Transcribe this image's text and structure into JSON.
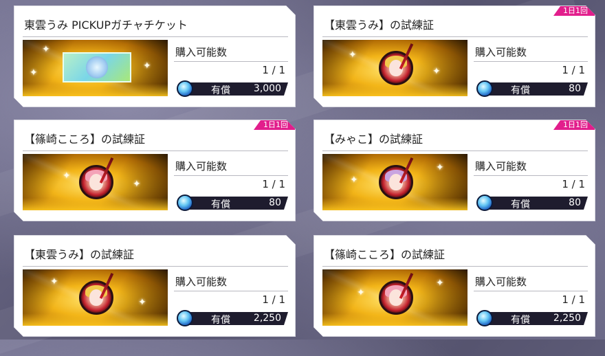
{
  "labels": {
    "purchase_available": "購入可能数",
    "paid": "有償"
  },
  "cards": [
    {
      "title": "東雲うみ PICKUPガチャチケット",
      "count": "1 / 1",
      "price": "3,000",
      "badge": "",
      "icon": "gacha-ticket"
    },
    {
      "title": "【東雲うみ】の試練証",
      "count": "1 / 1",
      "price": "80",
      "badge": "1日1回",
      "icon": "trial-medal-umi"
    },
    {
      "title": "【篠崎こころ】の試練証",
      "count": "1 / 1",
      "price": "80",
      "badge": "1日1回",
      "icon": "trial-medal-kokoro"
    },
    {
      "title": "【みゃこ】の試練証",
      "count": "1 / 1",
      "price": "80",
      "badge": "1日1回",
      "icon": "trial-medal-myako"
    },
    {
      "title": "【東雲うみ】の試練証",
      "count": "1 / 1",
      "price": "2,250",
      "badge": "",
      "icon": "trial-medal-umi"
    },
    {
      "title": "【篠崎こころ】の試練証",
      "count": "1 / 1",
      "price": "2,250",
      "badge": "",
      "icon": "trial-medal-kokoro"
    }
  ],
  "colors": {
    "badge": "#e21e8c",
    "price_bar": "#1e1c2e",
    "thumb_gold": "#f2b418"
  }
}
